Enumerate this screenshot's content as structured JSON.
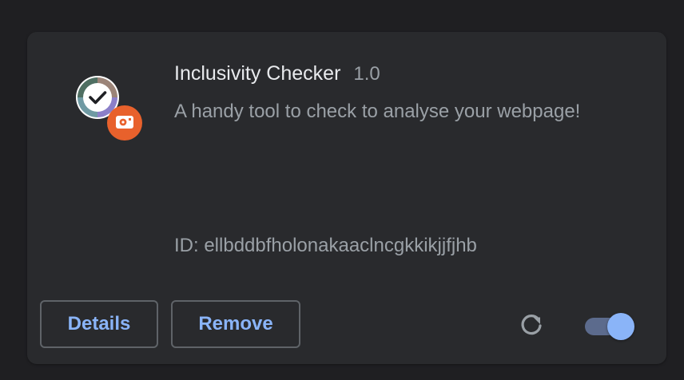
{
  "extension": {
    "name": "Inclusivity Checker",
    "version": "1.0",
    "description": "A handy tool to check to analyse your webpage!",
    "id_text": "ID: ellbddbfholonakaaclncgkkikjjfjhb",
    "icon": "check-circle-icon",
    "badge_icon": "extension-badge-icon",
    "enabled": true
  },
  "actions": {
    "details_label": "Details",
    "remove_label": "Remove",
    "reload_icon": "reload-icon"
  },
  "colors": {
    "card_background": "#292a2d",
    "accent": "#8ab4f8",
    "primary_text": "#e8eaed",
    "secondary_text": "#9aa0a6",
    "badge": "#e8612c"
  }
}
